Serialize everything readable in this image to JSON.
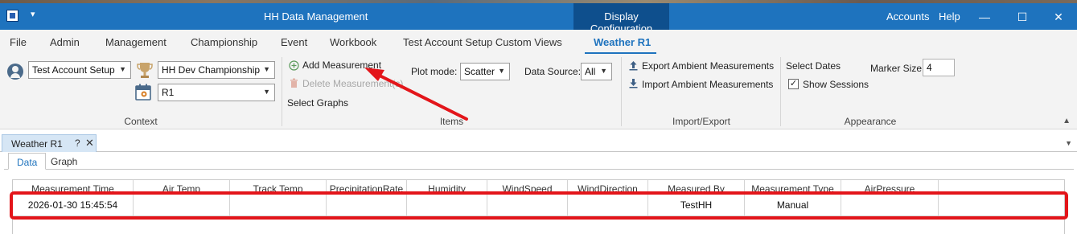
{
  "titlebar": {
    "qa_toolbar_glyph": "▾",
    "title": "HH Data Management",
    "context_tab": "Display Configuration",
    "accounts": "Accounts",
    "help": "Help",
    "minimize_glyph": "—",
    "maximize_glyph": "☐",
    "close_glyph": "✕"
  },
  "menu": {
    "tabs": [
      "File",
      "Admin",
      "Management",
      "Championship",
      "Event",
      "Workbook",
      "Test Account Setup Custom Views",
      "Weather R1"
    ],
    "active": "Weather R1"
  },
  "ribbon": {
    "context": {
      "account_select": "Test Account Setup",
      "championship_select": "HH Dev Championship",
      "event_select": "R1",
      "group_label": "Context"
    },
    "items": {
      "add_measurement": "Add Measurement",
      "delete_measurements": "Delete Measurement(s)",
      "select_graphs": "Select Graphs",
      "plot_mode_label": "Plot mode:",
      "plot_mode_value": "Scatter",
      "data_source_label": "Data Source:",
      "data_source_value": "All",
      "group_label": "Items"
    },
    "import_export": {
      "export": "Export Ambient Measurements",
      "import": "Import Ambient Measurements",
      "group_label": "Import/Export"
    },
    "appearance": {
      "select_dates": "Select Dates",
      "show_sessions": "Show Sessions",
      "show_sessions_checked": true,
      "marker_size_label": "Marker Size",
      "marker_size_value": "4",
      "group_label": "Appearance"
    }
  },
  "document": {
    "tab_label": "Weather R1",
    "tab_help": "?",
    "tab_close": "✕",
    "inner_tabs": [
      "Data",
      "Graph"
    ],
    "active_inner_tab": "Data"
  },
  "grid": {
    "columns": [
      "Measurement Time",
      "Air Temp",
      "Track Temp",
      "PrecipitationRate",
      "Humidity",
      "WindSpeed",
      "WindDirection",
      "Measured By",
      "Measurement Type",
      "AirPressure",
      ""
    ],
    "rows": [
      [
        "2026-01-30 15:45:54",
        "",
        "",
        "",
        "",
        "",
        "",
        "TestHH",
        "Manual",
        "",
        ""
      ]
    ]
  },
  "colors": {
    "accent": "#1e73be",
    "context_tab_bg": "#0e4f8d",
    "annotation": "#e3151a"
  },
  "icons": {
    "add": "plus-circle-icon",
    "delete": "trash-icon",
    "export": "upload-arrow-icon",
    "import": "download-arrow-icon",
    "user": "user-icon",
    "trophy": "trophy-icon",
    "calendar": "calendar-pin-icon"
  }
}
